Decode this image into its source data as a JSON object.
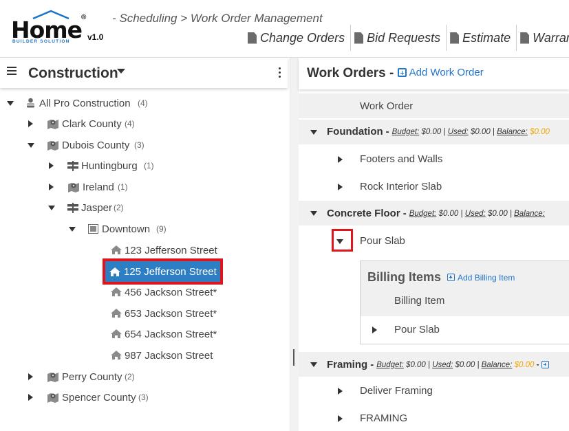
{
  "header": {
    "logo_text": "Home",
    "logo_registered": "®",
    "logo_subtitle": "BUILDER SOLUTION",
    "logo_version": "v1.0",
    "breadcrumb": "- Scheduling > Work Order Management",
    "nav": [
      "Change Orders",
      "Bid Requests",
      "Estimate",
      "Warranty"
    ]
  },
  "left_panel": {
    "title": "Construction",
    "tree": [
      {
        "label": "All Pro Construction",
        "count": "(4)",
        "icon": "person-icon"
      },
      {
        "label": "Clark County",
        "count": "(4)",
        "icon": "map-icon"
      },
      {
        "label": "Dubois County",
        "count": "(3)",
        "icon": "map-icon"
      },
      {
        "label": "Huntingburg",
        "count": "(1)",
        "icon": "signpost-icon"
      },
      {
        "label": "Ireland",
        "count": "(1)",
        "icon": "map-icon"
      },
      {
        "label": "Jasper",
        "count": "(2)",
        "icon": "signpost-icon"
      },
      {
        "label": "Downtown",
        "count": "(9)",
        "icon": "neighborhood-icon"
      },
      {
        "label": "123 Jefferson Street",
        "icon": "house-icon"
      },
      {
        "label": "125 Jefferson Street",
        "icon": "house-icon",
        "selected": true
      },
      {
        "label": "456 Jackson Street*",
        "icon": "house-icon"
      },
      {
        "label": "653 Jackson Street*",
        "icon": "house-icon"
      },
      {
        "label": "654 Jackson Street*",
        "icon": "house-icon"
      },
      {
        "label": "987 Jackson Street",
        "icon": "house-icon"
      },
      {
        "label": "Perry County",
        "count": "(2)",
        "icon": "map-icon"
      },
      {
        "label": "Spencer County",
        "count": "(3)",
        "icon": "map-icon"
      }
    ]
  },
  "right_panel": {
    "title": "Work Orders -",
    "add_work_order": "Add Work Order",
    "column_header": "Work Order",
    "groups": [
      {
        "title": "Foundation",
        "budget_label": "Budget:",
        "budget": "$0.00",
        "used_label": "Used:",
        "used": "$0.00",
        "balance_label": "Balance:",
        "balance": "$0.00",
        "items": [
          "Footers and Walls",
          "Rock Interior Slab"
        ]
      },
      {
        "title": "Concrete Floor",
        "budget_label": "Budget:",
        "budget": "$0.00",
        "used_label": "Used:",
        "used": "$0.00",
        "balance_label": "Balance:",
        "items": [
          "Pour Slab"
        ]
      },
      {
        "title": "Framing",
        "budget_label": "Budget:",
        "budget": "$0.00",
        "used_label": "Used:",
        "used": "$0.00",
        "balance_label": "Balance:",
        "balance": "$0.00",
        "items": [
          "Deliver Framing",
          "FRAMING"
        ]
      }
    ],
    "billing": {
      "title": "Billing Items",
      "add_label": "Add Billing Item",
      "column_header": "Billing Item",
      "rows": [
        "Pour Slab"
      ]
    }
  },
  "colors": {
    "accent": "#2276c9",
    "selected_bg": "#2d7ec3",
    "highlight": "#e0151b",
    "balance": "#f0a500"
  }
}
